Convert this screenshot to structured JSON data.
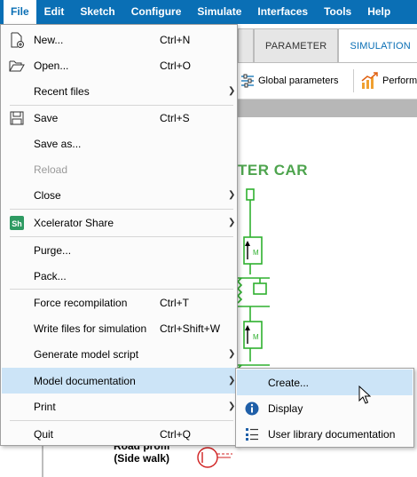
{
  "menubar": {
    "items": [
      "File",
      "Edit",
      "Sketch",
      "Configure",
      "Simulate",
      "Interfaces",
      "Tools",
      "Help"
    ]
  },
  "tabs": {
    "parameter": "PARAMETER",
    "simulation": "SIMULATION"
  },
  "ribbon": {
    "global_parameters": "Global parameters",
    "performance": "Perform"
  },
  "canvas": {
    "title_fragment": "TER CAR",
    "road_label_line1": "Road profil",
    "road_label_line2": "(Side walk)"
  },
  "file_menu": {
    "new": {
      "label": "New...",
      "shortcut": "Ctrl+N"
    },
    "open": {
      "label": "Open...",
      "shortcut": "Ctrl+O"
    },
    "recent": {
      "label": "Recent files"
    },
    "save": {
      "label": "Save",
      "shortcut": "Ctrl+S"
    },
    "save_as": {
      "label": "Save as..."
    },
    "reload": {
      "label": "Reload"
    },
    "close": {
      "label": "Close"
    },
    "xcelerator": {
      "label": "Xcelerator Share"
    },
    "purge": {
      "label": "Purge..."
    },
    "pack": {
      "label": "Pack..."
    },
    "force_recompile": {
      "label": "Force recompilation",
      "shortcut": "Ctrl+T"
    },
    "write_files": {
      "label": "Write files for simulation",
      "shortcut": "Ctrl+Shift+W"
    },
    "gen_script": {
      "label": "Generate model script"
    },
    "model_doc": {
      "label": "Model documentation"
    },
    "print": {
      "label": "Print"
    },
    "quit": {
      "label": "Quit",
      "shortcut": "Ctrl+Q"
    }
  },
  "submenu": {
    "create": "Create...",
    "display": "Display",
    "user_lib": "User library documentation"
  },
  "colors": {
    "accent": "#0a6fb5",
    "highlight": "#cce4f7",
    "model_green": "#2fb02f",
    "title_green": "#4ea44e"
  }
}
